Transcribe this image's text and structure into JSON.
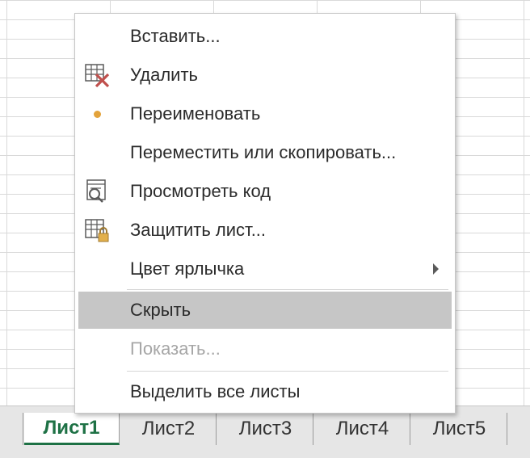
{
  "menu": {
    "items": [
      {
        "label": "Вставить...",
        "icon": "",
        "state": "normal"
      },
      {
        "label": "Удалить",
        "icon": "delete-sheet-icon",
        "state": "normal"
      },
      {
        "label": "Переименовать",
        "icon": "rename-dot-icon",
        "state": "normal"
      },
      {
        "label": "Переместить или скопировать...",
        "icon": "",
        "state": "normal"
      },
      {
        "label": "Просмотреть код",
        "icon": "view-code-icon",
        "state": "normal"
      },
      {
        "label": "Защитить лист...",
        "icon": "protect-sheet-icon",
        "state": "normal"
      },
      {
        "label": "Цвет ярлычка",
        "icon": "",
        "state": "normal",
        "submenu": true
      },
      {
        "label": "Скрыть",
        "icon": "",
        "state": "hover"
      },
      {
        "label": "Показать...",
        "icon": "",
        "state": "disabled"
      },
      {
        "label": "Выделить все листы",
        "icon": "",
        "state": "normal"
      }
    ]
  },
  "tabs": [
    {
      "label": "Лист1",
      "active": true
    },
    {
      "label": "Лист2",
      "active": false
    },
    {
      "label": "Лист3",
      "active": false
    },
    {
      "label": "Лист4",
      "active": false
    },
    {
      "label": "Лист5",
      "active": false
    }
  ],
  "colors": {
    "active_tab": "#1e7145",
    "hover_bg": "#c6c6c6",
    "disabled_text": "#a6a6a6",
    "rename_dot": "#e3a33b",
    "delete_x": "#c0504d"
  }
}
